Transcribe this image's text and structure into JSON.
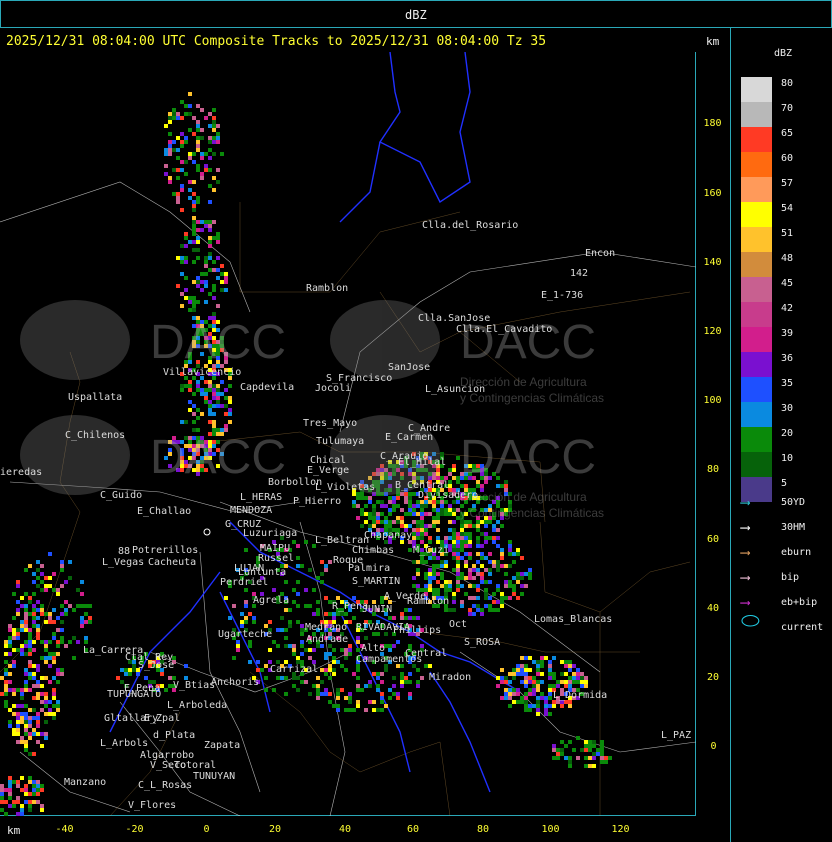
{
  "header": {
    "title": "dBZ",
    "subtitle": "2025/12/31 08:04:00 UTC Composite Tracks to 2025/12/31 08:04:00 Tz 35",
    "unit_corner": "km"
  },
  "legend": {
    "title": "dBZ",
    "levels": [
      {
        "value": "80",
        "color": "#d8d8d8"
      },
      {
        "value": "70",
        "color": "#b8b8b8"
      },
      {
        "value": "65",
        "color": "#ff3a24"
      },
      {
        "value": "60",
        "color": "#ff6a10"
      },
      {
        "value": "57",
        "color": "#ff9a5a"
      },
      {
        "value": "54",
        "color": "#ffff00"
      },
      {
        "value": "51",
        "color": "#ffc22c"
      },
      {
        "value": "48",
        "color": "#d28c3c"
      },
      {
        "value": "45",
        "color": "#c86090"
      },
      {
        "value": "42",
        "color": "#c83c8c"
      },
      {
        "value": "39",
        "color": "#d21e8c"
      },
      {
        "value": "36",
        "color": "#7a10d0"
      },
      {
        "value": "35",
        "color": "#1e50ff"
      },
      {
        "value": "30",
        "color": "#0a8ae0"
      },
      {
        "value": "20",
        "color": "#0a8a0a"
      },
      {
        "value": "10",
        "color": "#06620a"
      },
      {
        "value": "5",
        "color": "#4a3a8a"
      }
    ],
    "tracks": [
      {
        "label": "50YD",
        "color": "#30c8d8"
      },
      {
        "label": "30HM",
        "color": "#ffffff"
      },
      {
        "label": "eburn",
        "color": "#e0a060"
      },
      {
        "label": "bip",
        "color": "#f0c0d8"
      },
      {
        "label": "eb+bip",
        "color": "#d030d0"
      },
      {
        "label": "current",
        "color": "#20c8e0"
      }
    ]
  },
  "axes": {
    "unit": "km",
    "x_ticks": [
      "-40",
      "-20",
      "0",
      "20",
      "40",
      "60",
      "80",
      "100",
      "120"
    ],
    "y_ticks": [
      "180",
      "160",
      "140",
      "120",
      "100",
      "80",
      "60",
      "40",
      "20",
      "0"
    ]
  },
  "watermark": {
    "logo_text": "DACC",
    "subtitle_line1": "Dirección de Agricultura",
    "subtitle_line2": "y Contingencias Climáticas"
  },
  "places": [
    "Clla.del_Rosario",
    "Encon",
    "142",
    "E_1-736",
    "Ramblon",
    "Clla.SanJose",
    "Clla.El_Cavadito",
    "Villavicencio",
    "Capdevila",
    "S_Francisco",
    "SanJose",
    "L_Asuncion",
    "Jocoli",
    "Uspallata",
    "C_Chilenos",
    "Tres_Mayo",
    "C_Andre",
    "E_Carmen",
    "Tulumaya",
    "C_Araujo",
    "El_Hilal",
    "Chical",
    "E_Verge",
    "ieredas",
    "Borbollon",
    "L_Violetas",
    "B_Central",
    "Divisadero",
    "C_Guido",
    "L_HERAS",
    "P_Hierro",
    "E_Challao",
    "MENDOZA",
    "G_CRUZ",
    "Luzuriaga",
    "L_Beltran",
    "Chapanay",
    "M_Cuzi",
    "MAIPU",
    "Chimbas",
    "Potrerillos",
    "Russel",
    "L_Vegas",
    "Cacheuta",
    "LUJAN",
    "Roque",
    "Palmira",
    "Perdriel",
    "S_MARTIN",
    "A_Verde",
    "Ramblon",
    "Agrela",
    "R_Pena",
    "JUNIN",
    "Lomas_Blancas",
    "Ugarteche",
    "Medrano",
    "RIVADAVIA",
    "Phillips",
    "Oct",
    "Andrade",
    "S_ROSA",
    "La_Carrera",
    "Ctal_Rey",
    "S_Jose",
    "Carrizal",
    "Alto",
    "Central",
    "Campamentos",
    "L_Dormida",
    "Anchoris",
    "Miradon",
    "V_Btias",
    "E_Pena",
    "TUPUNGATO",
    "L_Arboleda",
    "Gltallary",
    "E_Zpal",
    "d_Plata",
    "L_Arbols",
    "Zapata",
    "Algarrobo",
    "V_Seco",
    "Totoral",
    "TUNUYAN",
    "Manzano",
    "C_L_Rosas",
    "V_Flores",
    "L_PAZ",
    "Lunlunta",
    "88"
  ]
}
